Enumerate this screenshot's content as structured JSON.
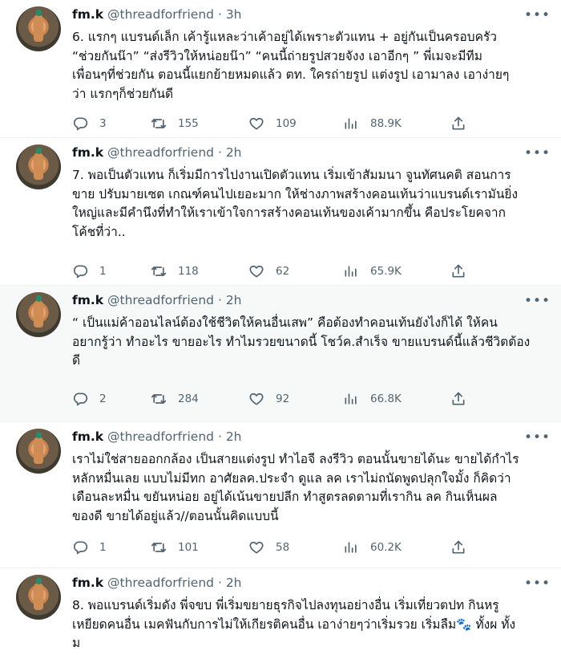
{
  "tweets": [
    {
      "name": "fm.k",
      "handle": "@threadforfriend",
      "dot": "·",
      "time": "3h",
      "lines": [
        "6. แรกๆ แบรนด์เล็ก เค้ารู้แหละว่าเค้าอยู่ได้เพราะตัวแทน + อยู่กันเป็นครอบครัว",
        "“ช่วยกันน๊า” “ส่งรีวิวให้หน่อยน๊า” “คนนี้ถ่ายรูปสวยจังง เอาอีกๆ ” พี่เมจะมีทีม",
        "เพื่อนๆที่ช่วยกัน ตอนนี้แยกย้ายหมดแล้ว ตท. ใครถ่ายรูป แต่งรูป เอามาลง เอาง่ายๆ",
        "ว่า แรกๆก็ช่วยกันดี"
      ],
      "replies": "3",
      "retweets": "155",
      "likes": "109",
      "views": "88.9K"
    },
    {
      "name": "fm.k",
      "handle": "@threadforfriend",
      "dot": "·",
      "time": "2h",
      "lines": [
        "7. พอเป็นตัวแทน ก็เริ่มมีการไปงานเปิดตัวแทน เริ่มเข้าสัมมนา จูนทัศนคติ สอนการ",
        "ขาย ปรับมายเซต เกณฑ์คนไปเยอะมาก ให้ช่างภาพสร้างคอนเท้นว่าแบรนด์เรามันยิ่ง",
        "ใหญ่และมีคำนึงที่ทำให้เราเข้าใจการสร้างคอนเท้นของเค้ามากขึ้น คือประโยคจาก",
        "โค้ชที่ว่า.."
      ],
      "replies": "1",
      "retweets": "118",
      "likes": "62",
      "views": "65.9K"
    },
    {
      "name": "fm.k",
      "handle": "@threadforfriend",
      "dot": "·",
      "time": "2h",
      "lines": [
        "“ เป็นแม่ค้าออนไลน์ต้องใช้ชีวิตให้คนอื่นเสพ” คือต้องทำคอนเท้นยังไงก็ได้ ให้คน",
        "อยากรู้ว่า ทำอะไร ขายอะไร ทำไมรวยขนาดนี้ โชว์ค.สำเร็จ ขายแบรนด์นี้แล้วชีวิตต้อง",
        "ดี"
      ],
      "replies": "2",
      "retweets": "284",
      "likes": "92",
      "views": "66.8K"
    },
    {
      "name": "fm.k",
      "handle": "@threadforfriend",
      "dot": "·",
      "time": "2h",
      "lines": [
        "เราไม่ใช่สายออกกล้อง เป็นสายแต่งรูป ทำไอจี ลงรีวิว ตอนนั้นขายได้นะ ขายได้กำไร",
        "หลักหมื่นเลย แบบไม่มีทก อาศัยลค.ประจำ ดูแล ลค เราไม่ถนัดพูดปลุกใจมั้ง ก็คิดว่า",
        "เดือนละหมื่น ขยันหน่อย อยู่ได้เน้นขายปลีก ทำสูตรลดตามที่เรากิน ลค กินเห็นผล",
        "ของดี ขายได้อยู่แล้ว//ตอนนั้นคิดแบบนี้"
      ],
      "replies": "1",
      "retweets": "101",
      "likes": "58",
      "views": "60.2K"
    },
    {
      "name": "fm.k",
      "handle": "@threadforfriend",
      "dot": "·",
      "time": "2h",
      "lines": [
        "8. พอแบรนด์เริ่มดัง พี่จขบ พี่เริ่มขยายธุรกิจไปลงทุนอย่างอื่น เริ่มเที่ยวตปท กินหรู",
        "เหยียดคนอื่น เมคฟันกับการไม่ให้เกียรติคนอื่น เอาง่ายๆว่าเริ่มรวย เริ่มลืม🐾 ทั้งผ ทั้ง",
        "ม"
      ]
    }
  ],
  "icons": {
    "reply": "reply-icon",
    "retweet": "retweet-icon",
    "like": "heart-icon",
    "views": "views-icon",
    "share": "share-icon",
    "more": "more-icon"
  },
  "colors": {
    "text": "#0f1419",
    "muted": "#536471",
    "divider": "#eff3f4",
    "hover_bg": "#f7f9f9"
  }
}
